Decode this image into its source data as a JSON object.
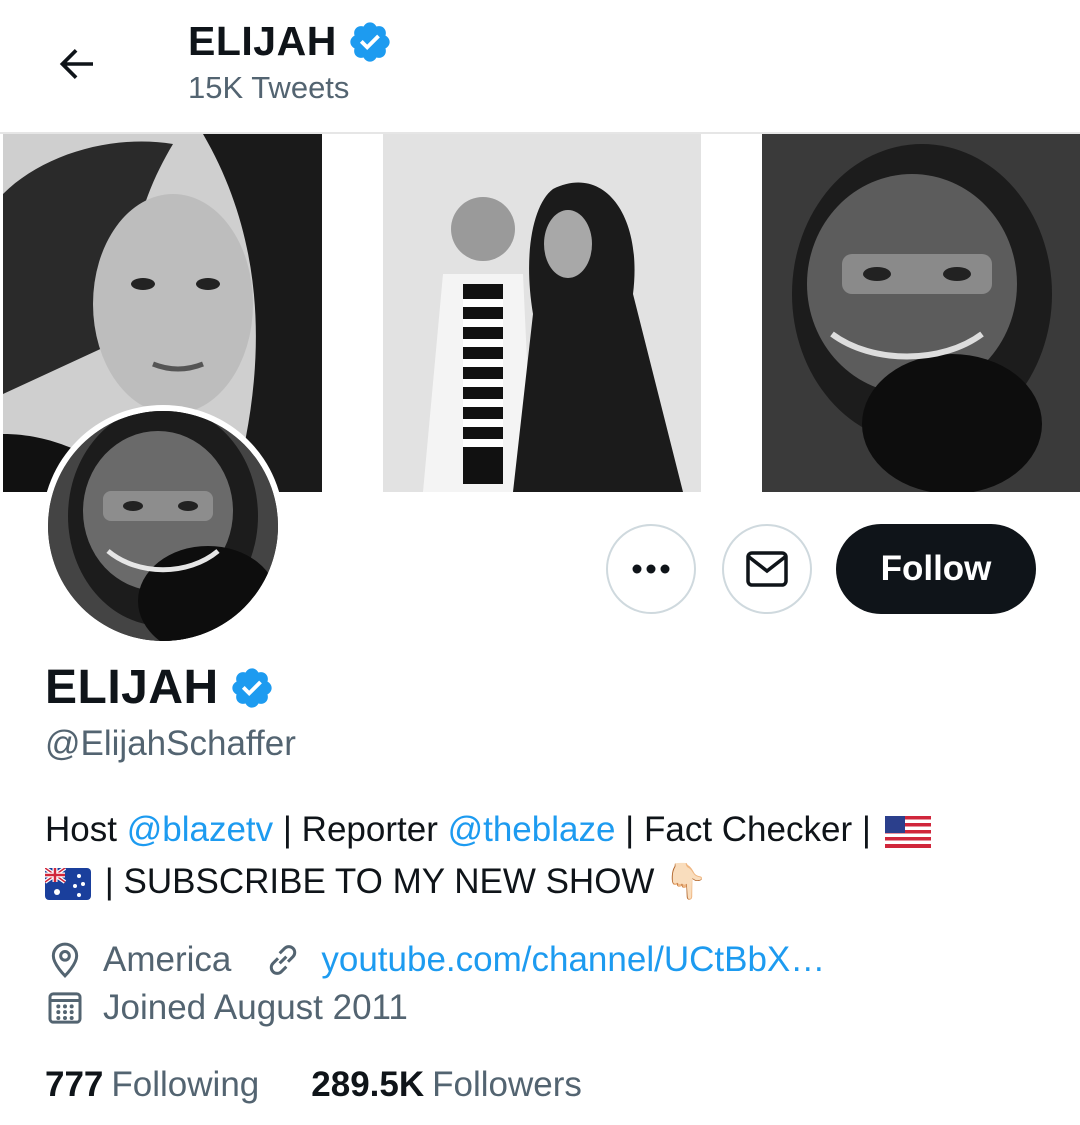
{
  "header": {
    "name": "ELIJAH",
    "tweets": "15K Tweets",
    "back_icon": "arrow-left-icon"
  },
  "banner": {
    "photos": [
      "portrait-woman",
      "couple-laughing",
      "man-gas-mask"
    ]
  },
  "profile": {
    "name": "ELIJAH",
    "handle": "@ElijahSchaffer",
    "verified_color": "#1d9bf0"
  },
  "actions": {
    "more_icon": "more-horizontal-icon",
    "message_icon": "envelope-icon",
    "follow_label": "Follow"
  },
  "bio": {
    "t1": "Host ",
    "m1": "@blazetv",
    "t2": " | Reporter ",
    "m2": "@theblaze",
    "t3": " | Fact Checker | ",
    "t4": " | SUBSCRIBE TO MY NEW SHOW ",
    "emoji_point": "👇🏻"
  },
  "meta": {
    "location": "America",
    "link": "youtube.com/channel/UCtBbX…",
    "joined": "Joined August 2011"
  },
  "stats": {
    "following_count": "777",
    "following_label": "Following",
    "followers_count": "289.5K",
    "followers_label": "Followers"
  },
  "colors": {
    "accent": "#1d9bf0",
    "text": "#0f1419",
    "secondary": "#536471"
  }
}
